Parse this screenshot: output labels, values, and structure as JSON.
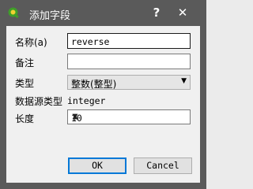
{
  "window": {
    "title": "添加字段",
    "help_label": "?",
    "close_label": "✕",
    "icon": "qgis-logo-icon",
    "icon_text": "Q"
  },
  "form": {
    "name_label": "名称(a)",
    "name_value": "reverse",
    "comment_label": "备注",
    "comment_value": "",
    "type_label": "类型",
    "type_value": "整数(整型)",
    "source_type_label": "数据源类型",
    "source_type_value": "integer",
    "length_label": "长度",
    "length_value": "10"
  },
  "buttons": {
    "ok_label": "OK",
    "cancel_label": "Cancel"
  },
  "colors": {
    "titlebar": "#5a5a5a",
    "qgis_green": "#3f9e29",
    "qgis_yellow": "#f0d230",
    "default_button_border": "#0078d7"
  }
}
